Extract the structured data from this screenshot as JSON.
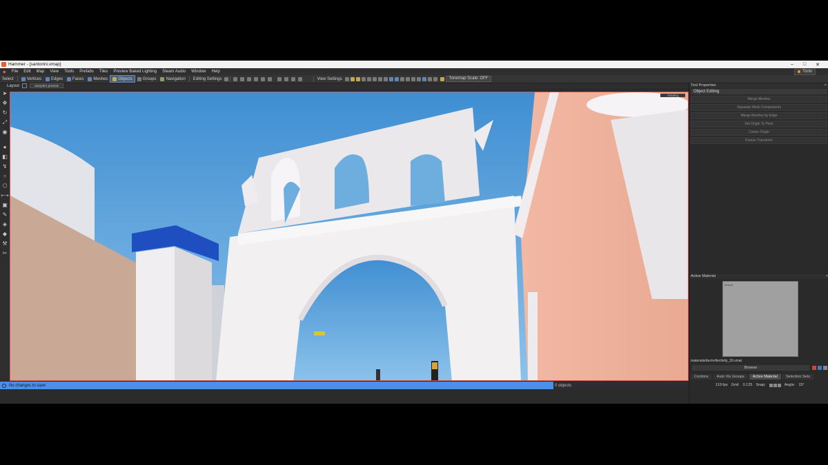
{
  "window": {
    "title": "Hammer - [santorini.vmap]",
    "controls": [
      "–",
      "□",
      "✕"
    ]
  },
  "menu": {
    "items": [
      "File",
      "Edit",
      "Map",
      "View",
      "Tools",
      "Prefabs",
      "Tiles",
      "Preview Baked Lighting",
      "Steam Audio",
      "Window",
      "Help"
    ],
    "tools_label": "Tools"
  },
  "toolbar": {
    "select": "Select",
    "modes": [
      "Vertices",
      "Edges",
      "Faces",
      "Meshes",
      "Objects",
      "Groups",
      "Navigation"
    ],
    "active_mode": "Objects",
    "editing_settings": "Editing Settings",
    "view_settings": "View Settings",
    "tonemap": "Tonemap Scale: OFF"
  },
  "layout": {
    "label": "Layout",
    "value": "Sample's preview"
  },
  "viewport": {
    "label": "shading"
  },
  "status": {
    "message": "No changes to save",
    "objects": "0 objects"
  },
  "tool_properties": {
    "title": "Tool Properties",
    "section": "Object Editing",
    "buttons": [
      "Merge Meshes",
      "Separate Mesh Components",
      "Merge Meshes by Edge",
      "Set Origin To Pivot",
      "Center Origin",
      "Freeze Transform"
    ]
  },
  "active_material": {
    "title": "Active Material",
    "thumb_label": "default",
    "path": "materials/dev/reflectivity_30.vmat",
    "browse": "Browse"
  },
  "bottom_tabs": [
    "Cordons",
    "Auto Vis Groups",
    "Active Material",
    "Selection Sets"
  ],
  "active_tab": "Active Material",
  "stats": {
    "fps": "119 fps",
    "grid_label": "Grid:",
    "grid": "0.125",
    "snap_label": "Snap:",
    "angle_label": "Angle:",
    "angle": "15°"
  },
  "colors": {
    "accent": "#4a90e8",
    "viewport_border": "#d4534f"
  }
}
